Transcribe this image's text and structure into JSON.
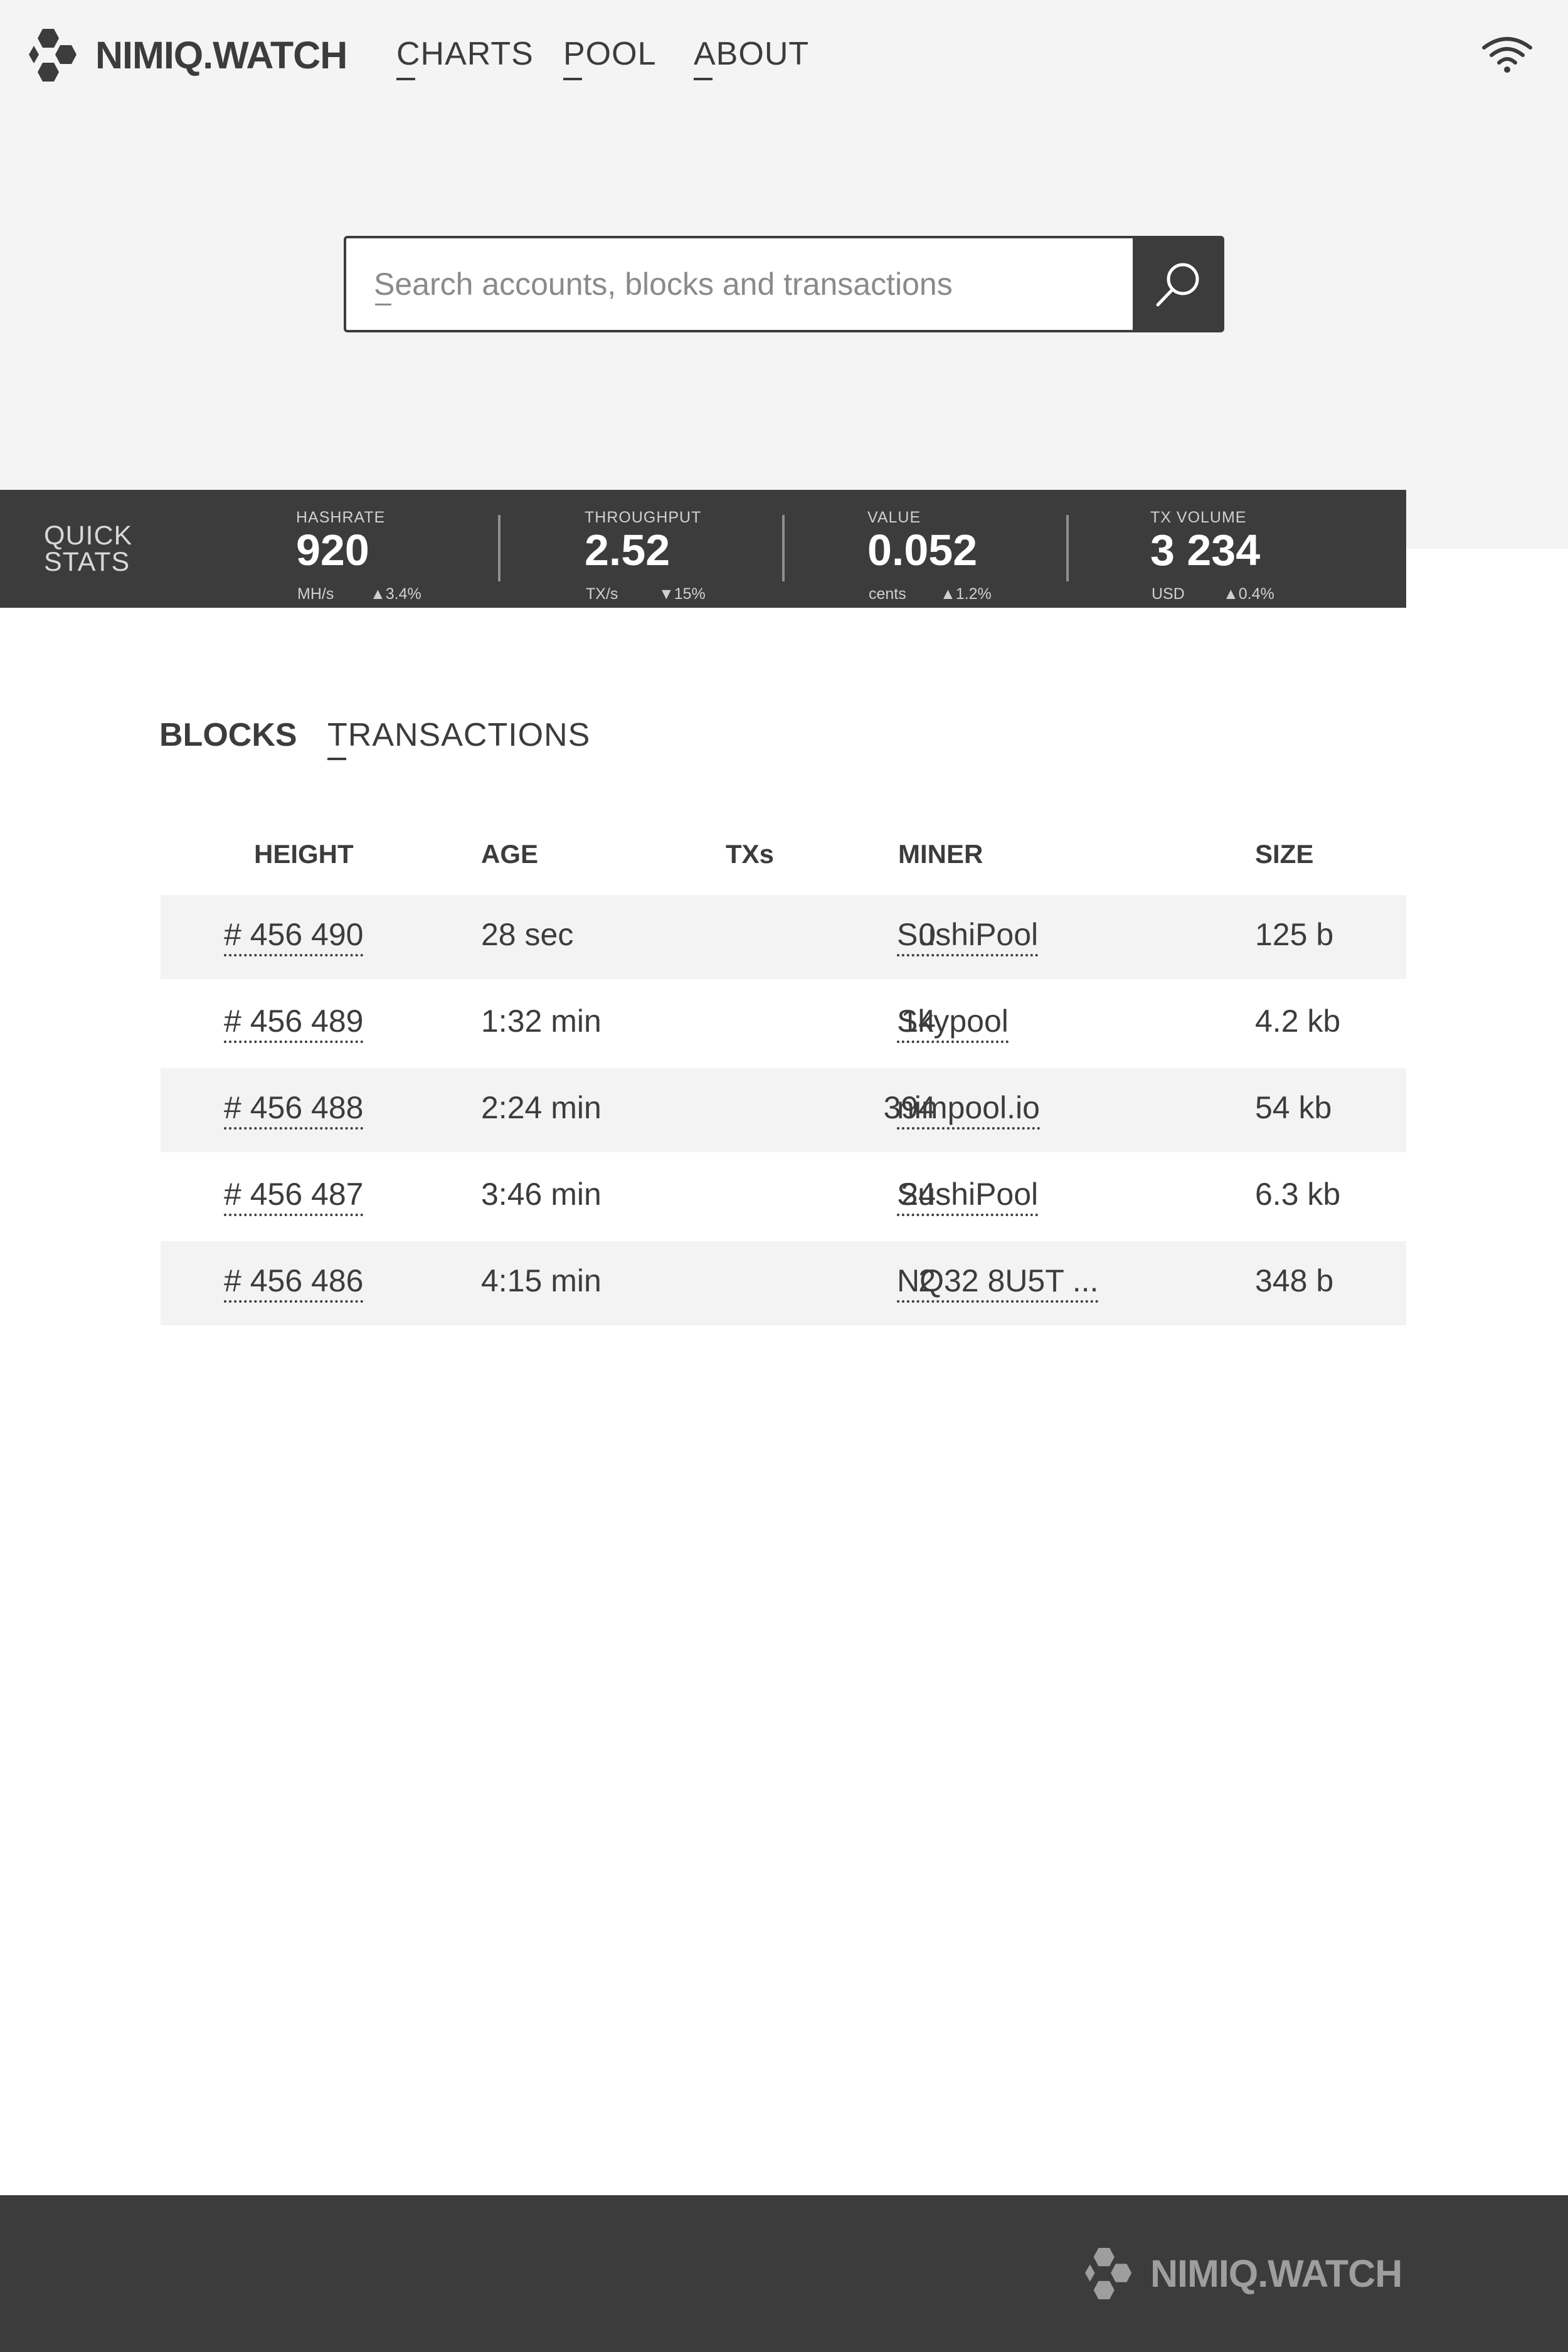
{
  "header": {
    "logo_text": "NIMIQ.WATCH",
    "logo_icon": "hexagon-cluster-icon",
    "nav": [
      {
        "label": "CHARTS"
      },
      {
        "label": "POOL"
      },
      {
        "label": "ABOUT"
      }
    ],
    "connection_icon": "wifi-icon"
  },
  "search": {
    "placeholder": "Search accounts, blocks and transactions",
    "button_icon": "search-icon"
  },
  "quick_stats": {
    "title_line1": "QUICK",
    "title_line2": "STATS",
    "items": [
      {
        "label": "HASHRATE",
        "value": "920",
        "unit": "MH/s",
        "change": "▲3.4%"
      },
      {
        "label": "THROUGHPUT",
        "value": "2.52",
        "unit": "TX/s",
        "change": "▼15%"
      },
      {
        "label": "VALUE",
        "value": "0.052",
        "unit": "cents",
        "change": "▲1.2%"
      },
      {
        "label": "TX VOLUME",
        "value": "3 234",
        "unit": "USD",
        "change": "▲0.4%"
      }
    ]
  },
  "tabs": [
    {
      "label": "BLOCKS",
      "active": true
    },
    {
      "label": "TRANSACTIONS",
      "active": false
    }
  ],
  "blocks_table": {
    "columns": [
      "HEIGHT",
      "AGE",
      "TXs",
      "MINER",
      "SIZE"
    ],
    "rows": [
      {
        "height": "# 456 490",
        "age": "28 sec",
        "txs": "0",
        "miner": "SushiPool",
        "size": "125 b"
      },
      {
        "height": "# 456 489",
        "age": "1:32 min",
        "txs": "14",
        "miner": "Skypool",
        "size": "4.2 kb"
      },
      {
        "height": "# 456 488",
        "age": "2:24 min",
        "txs": "394",
        "miner": "nimpool.io",
        "size": "54 kb"
      },
      {
        "height": "# 456 487",
        "age": "3:46 min",
        "txs": "24",
        "miner": "SushiPool",
        "size": "6.3 kb"
      },
      {
        "height": "# 456 486",
        "age": "4:15 min",
        "txs": "2",
        "miner": "NQ32 8U5T ...",
        "size": "348 b"
      }
    ]
  },
  "footer": {
    "logo_text": "NIMIQ.WATCH"
  },
  "colors": {
    "dark": "#3c3c3c",
    "hero_bg": "#f4f4f4",
    "row_shade": "#f3f3f3",
    "footer_logo": "#9e9e9e"
  }
}
